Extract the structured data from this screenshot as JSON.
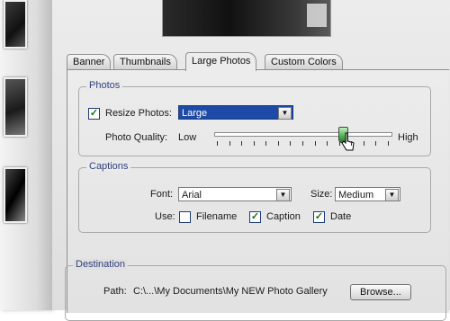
{
  "tabs": [
    {
      "label": "Banner",
      "active": false
    },
    {
      "label": "Thumbnails",
      "active": false
    },
    {
      "label": "Large Photos",
      "active": true
    },
    {
      "label": "Custom Colors",
      "active": false
    }
  ],
  "photos": {
    "group_title": "Photos",
    "resize_checked": true,
    "resize_label": "Resize Photos:",
    "resize_value": "Large",
    "quality_label": "Photo Quality:",
    "quality_low": "Low",
    "quality_high": "High",
    "quality_level": 0.73
  },
  "captions": {
    "group_title": "Captions",
    "font_label": "Font:",
    "font_value": "Arial",
    "size_label": "Size:",
    "size_value": "Medium",
    "use_label": "Use:",
    "filename_label": "Filename",
    "filename_checked": false,
    "caption_label": "Caption",
    "caption_checked": true,
    "date_label": "Date",
    "date_checked": true
  },
  "destination": {
    "group_title": "Destination",
    "path_label": "Path:",
    "path_value": "C:\\...\\My Documents\\My NEW Photo Gallery",
    "browse_label": "Browse..."
  },
  "colors": {
    "accent": "#1d4aa7",
    "group_title": "#2f3f7f",
    "check": "#1b6e1b"
  },
  "icons": {
    "checkmark": "checkmark-icon",
    "dropdown": "chevron-down-icon",
    "cursor": "hand-pointer-icon"
  }
}
